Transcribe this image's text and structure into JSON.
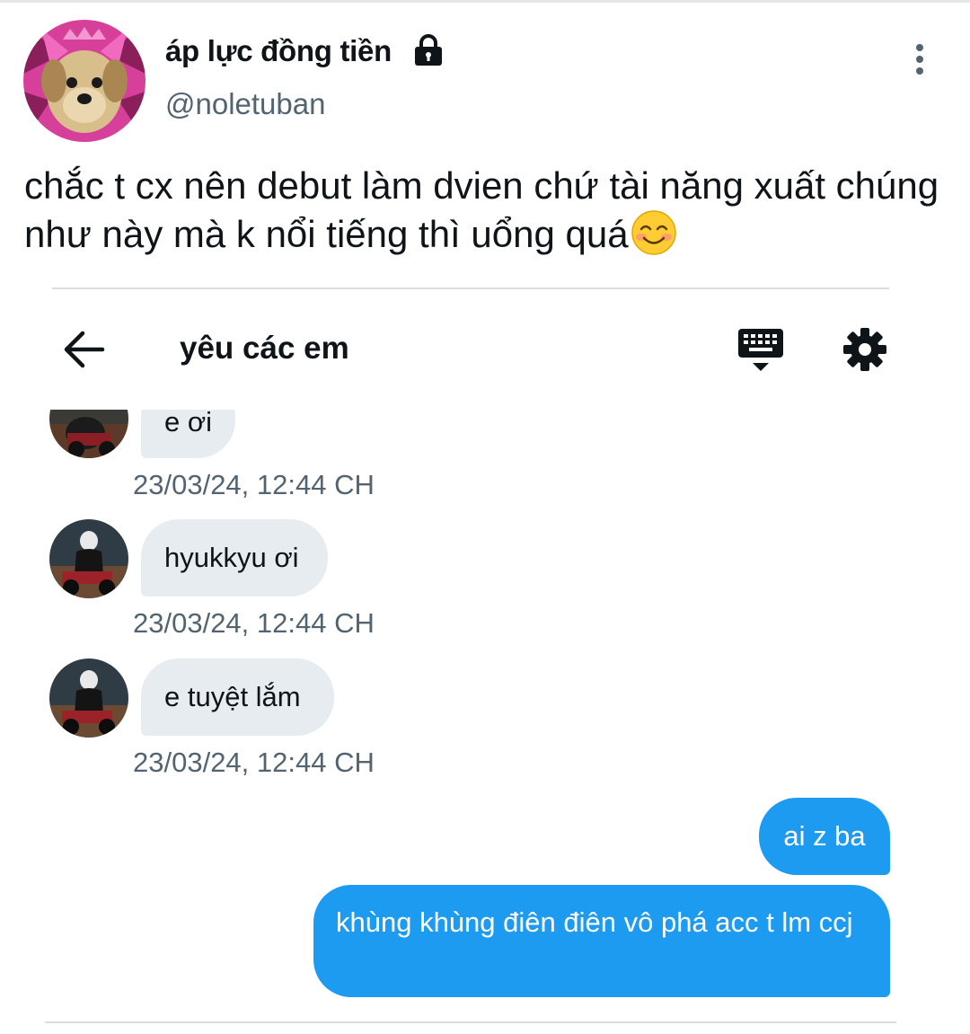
{
  "tweet": {
    "author": {
      "display_name": "áp lực đồng tiền",
      "handle": "@noletuban",
      "protected_icon": "lock-icon",
      "avatar_icon": "dog-avatar"
    },
    "more_icon": "more-vertical-icon",
    "text": "chắc t cx nên debut làm dvien chứ tài năng xuất chúng như này mà k nổi tiếng thì uổng quá",
    "emoji": "smiling-face-with-smiling-eyes-emoji"
  },
  "dm_screenshot": {
    "header": {
      "back_icon": "arrow-left-icon",
      "title": "yêu các em",
      "keyboard_icon": "keyboard-icon",
      "settings_icon": "gear-icon"
    },
    "messages": [
      {
        "direction": "incoming",
        "text": "e ơi",
        "timestamp": "23/03/24, 12:44 CH"
      },
      {
        "direction": "incoming",
        "text": "hyukkyu ơi",
        "timestamp": "23/03/24, 12:44 CH"
      },
      {
        "direction": "incoming",
        "text": "e tuyệt lắm",
        "timestamp": "23/03/24, 12:44 CH"
      },
      {
        "direction": "outgoing",
        "text": "ai z ba"
      },
      {
        "direction": "outgoing",
        "text": "khùng khùng điên điên vô phá acc t lm ccj"
      }
    ]
  },
  "colors": {
    "outgoing_bubble": "#1d9bf0",
    "incoming_bubble": "#e7ecf0",
    "secondary_text": "#536471",
    "primary_text": "#0f1419"
  }
}
